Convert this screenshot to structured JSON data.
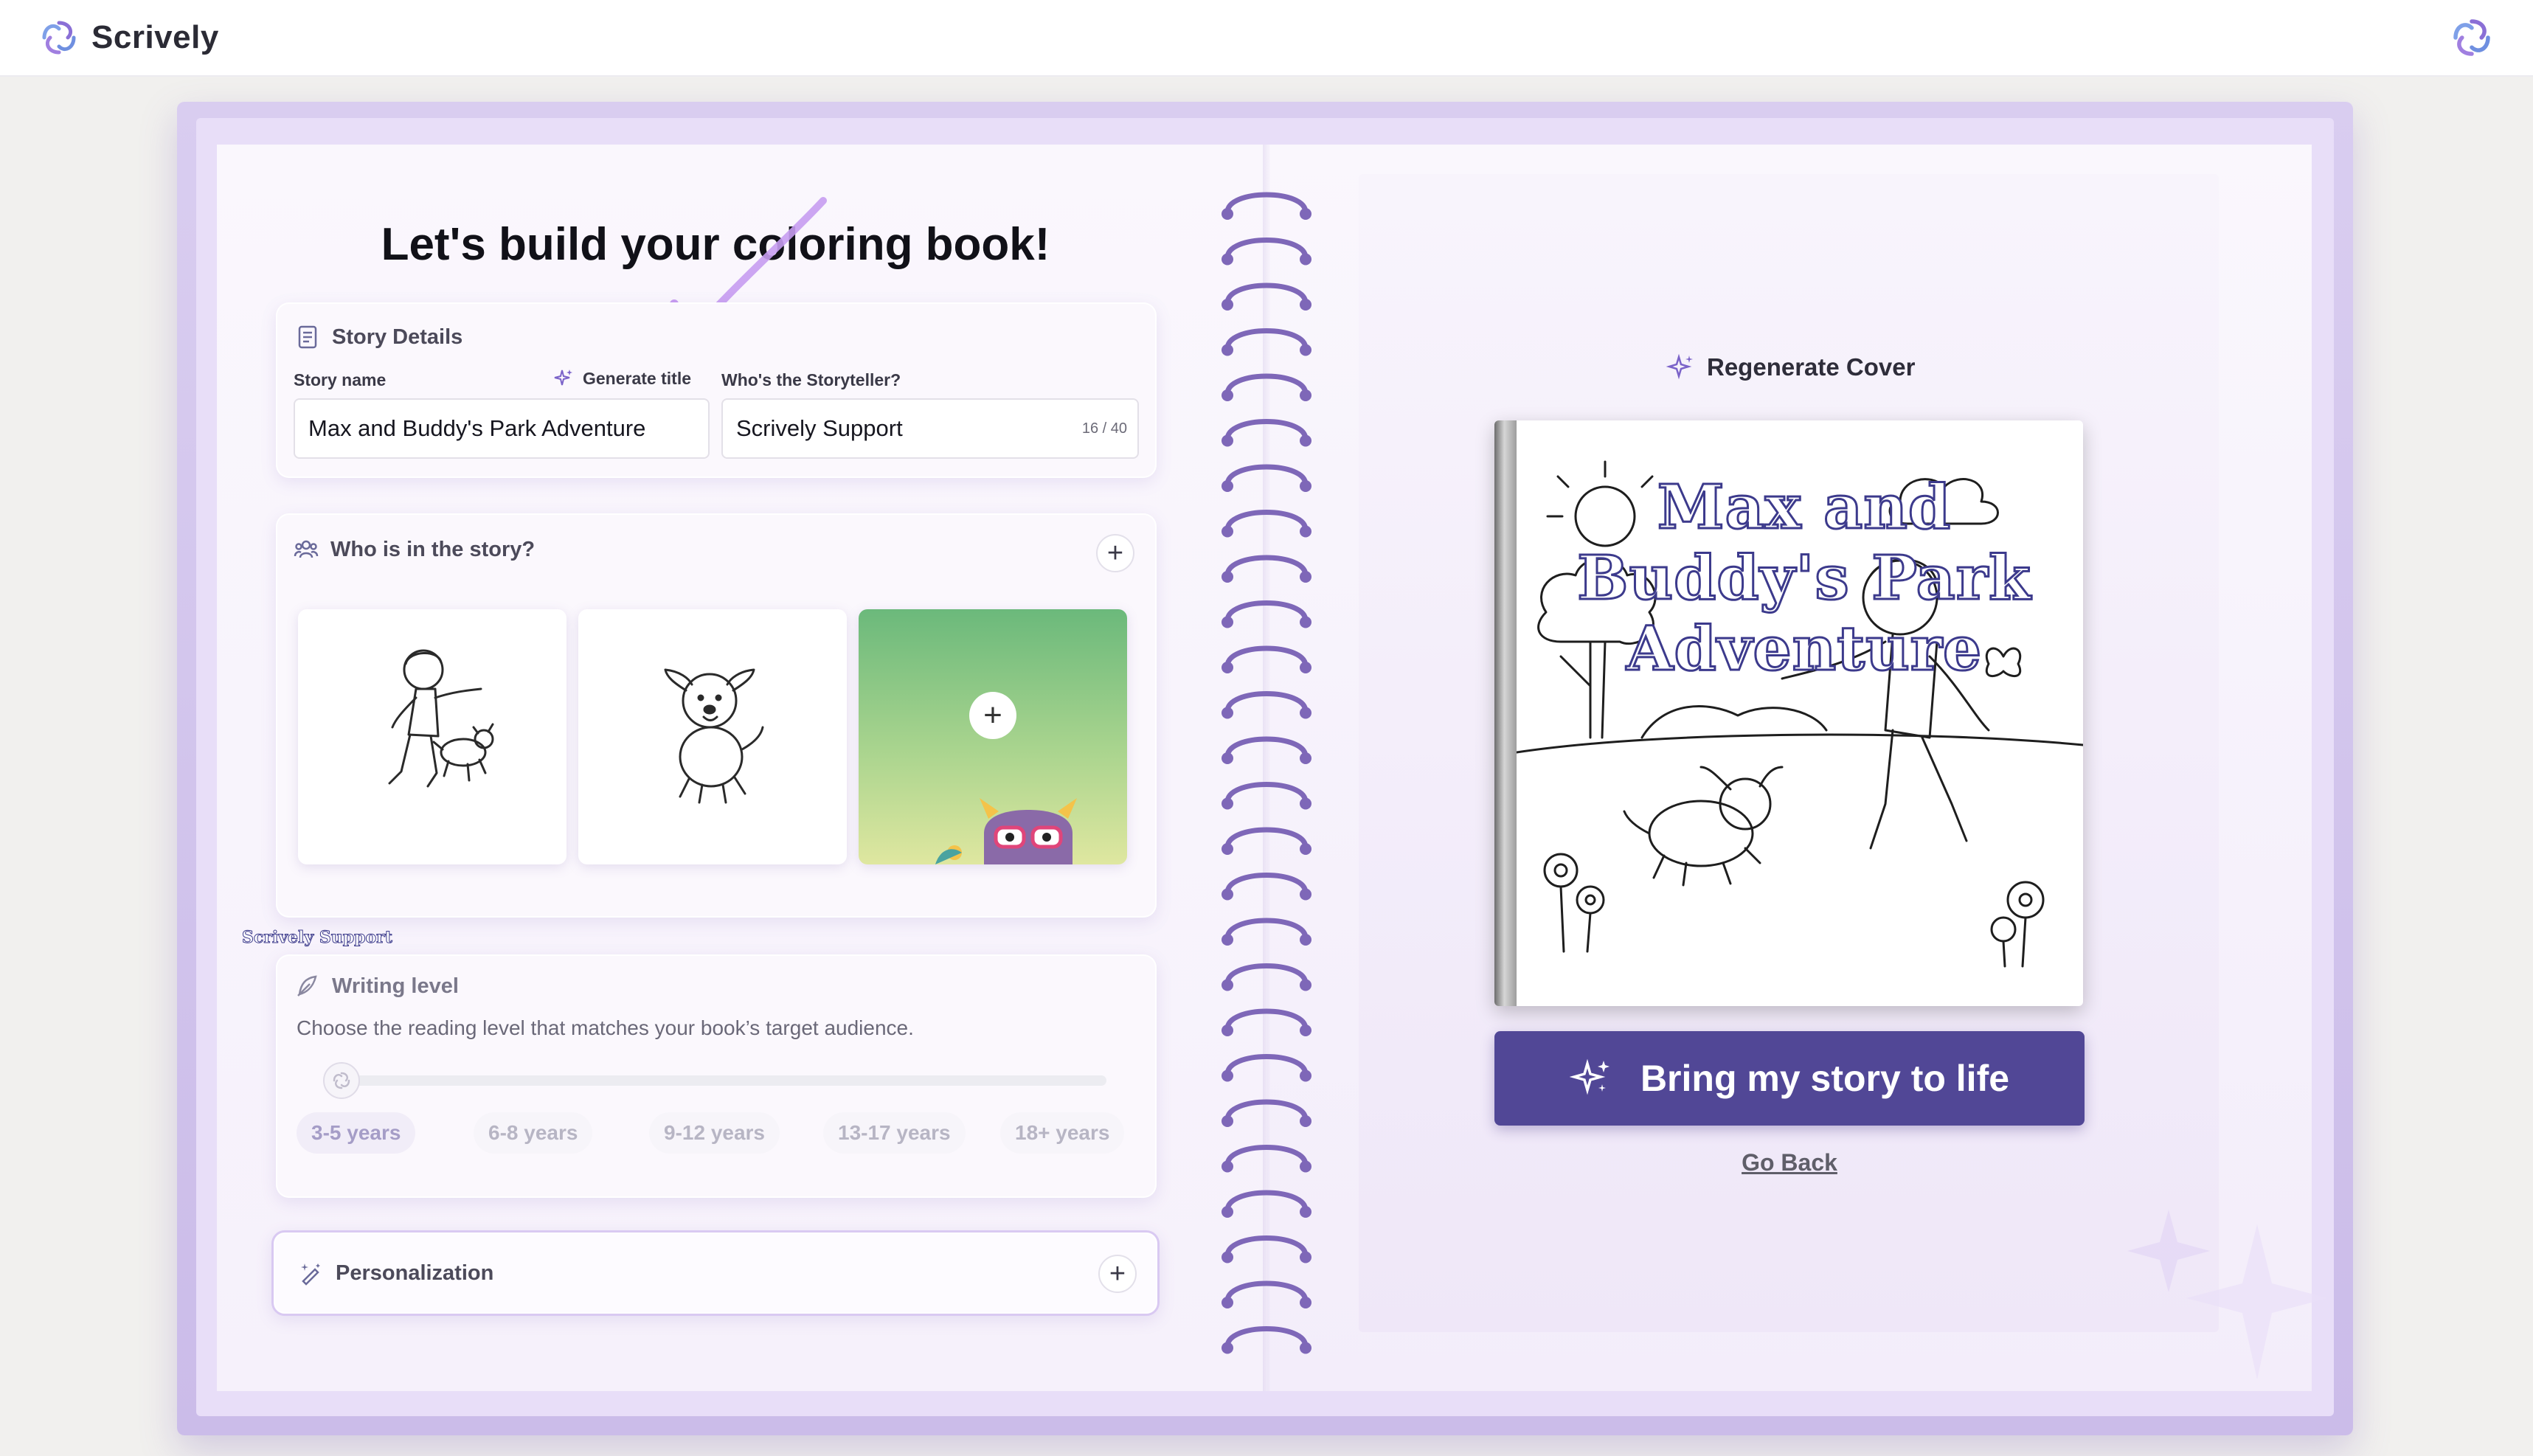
{
  "app": {
    "brand_name": "Scrively",
    "logo_icon": "scrively-swirl-logo",
    "accent_color": "#514796",
    "frame_color": "#d9cdf0"
  },
  "main": {
    "title": "Let's build your coloring book!"
  },
  "story_details": {
    "heading": "Story Details",
    "story_name_label": "Story name",
    "story_name_value": "Max and Buddy's Park Adventure",
    "generate_title_label": "Generate title",
    "storyteller_label": "Who's the Storyteller?",
    "storyteller_value": "Scrively Support",
    "storyteller_counter": "16 / 40"
  },
  "characters": {
    "heading": "Who is in the story?",
    "add_label": "+",
    "tiles": [
      {
        "name": "boy-and-puppy",
        "kind": "line-art"
      },
      {
        "name": "puppy",
        "kind": "line-art"
      },
      {
        "name": "add-character",
        "kind": "add",
        "plus": "+"
      }
    ]
  },
  "writing_level": {
    "heading": "Writing level",
    "description": "Choose the reading level that matches your book’s target audience.",
    "levels": [
      "3-5 years",
      "6-8 years",
      "9-12 years",
      "13-17 years",
      "18+ years"
    ],
    "selected": "3-5 years"
  },
  "personalization": {
    "heading": "Personalization",
    "expand_label": "+"
  },
  "cover": {
    "regenerate_label": "Regenerate Cover",
    "title": "Max and Buddy's Park Adventure",
    "title_lines": [
      "Max and",
      "Buddy's Park",
      "Adventure"
    ],
    "author": "Scrively Support"
  },
  "actions": {
    "primary": "Bring my story to life",
    "secondary": "Go Back"
  }
}
